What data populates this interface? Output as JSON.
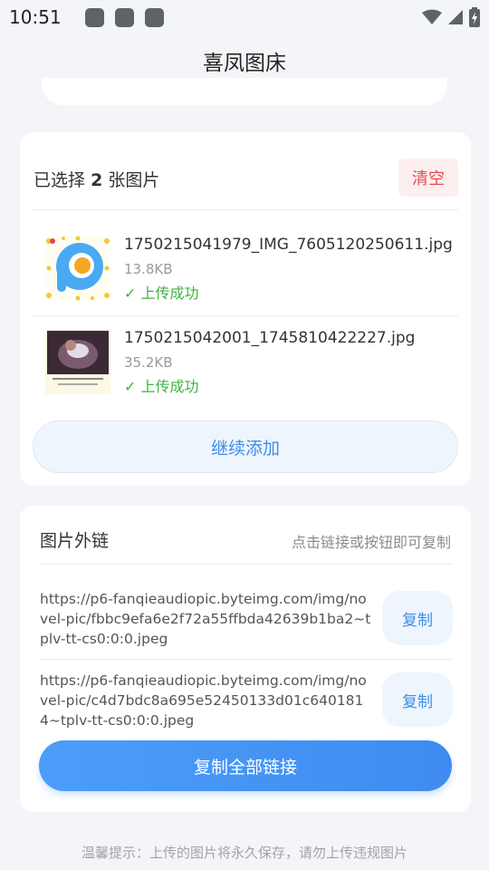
{
  "status_bar": {
    "time": "10:51"
  },
  "app_title": "喜凤图床",
  "selection": {
    "label_prefix": "已选择",
    "count": "2",
    "label_suffix": "张图片",
    "clear_label": "清空"
  },
  "files": [
    {
      "name": "1750215041979_IMG_7605120250611.jpg",
      "size": "13.8KB",
      "status": "✓ 上传成功"
    },
    {
      "name": "1750215042001_1745810422227.jpg",
      "size": "35.2KB",
      "status": "✓ 上传成功"
    }
  ],
  "add_more_label": "继续添加",
  "links": {
    "title": "图片外链",
    "hint": "点击链接或按钮即可复制",
    "items": [
      {
        "url": "https://p6-fanqieaudiopic.byteimg.com/img/novel-pic/fbbc9efa6e2f72a55ffbda42639b1ba2~tplv-tt-cs0:0:0.jpeg",
        "copy_label": "复制"
      },
      {
        "url": "https://p6-fanqieaudiopic.byteimg.com/img/novel-pic/c4d7bdc8a695e52450133d01c6401814~tplv-tt-cs0:0:0.jpeg",
        "copy_label": "复制"
      }
    ],
    "copy_all_label": "复制全部链接"
  },
  "footer_tip": "温馨提示：上传的图片将永久保存，请勿上传违规图片",
  "colors": {
    "accent": "#3d8fe8",
    "danger": "#e84a4f",
    "success": "#3fb23f"
  }
}
